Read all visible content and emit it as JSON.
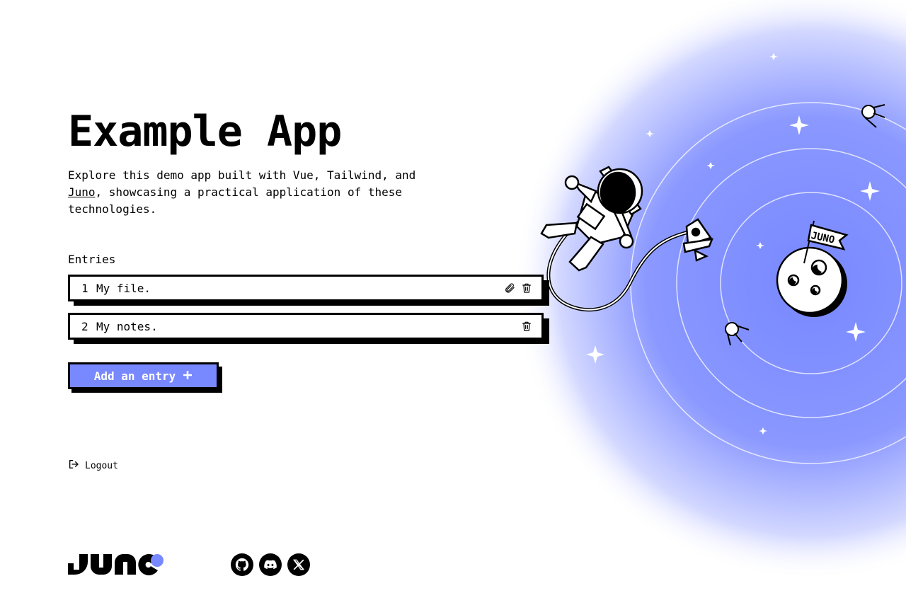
{
  "app": {
    "title": "Example App",
    "intro_before_link": "Explore this demo app built with Vue, Tailwind, and ",
    "intro_link": "Juno",
    "intro_after_link": ", showcasing a practical application of these technologies."
  },
  "entries": {
    "label": "Entries",
    "items": [
      {
        "number": "1",
        "text": "My file.",
        "has_attachment": true
      },
      {
        "number": "2",
        "text": "My notes.",
        "has_attachment": false
      }
    ]
  },
  "actions": {
    "add_entry_label": "Add an entry",
    "logout_label": "Logout"
  },
  "illustration": {
    "flag_text": "JUNO"
  },
  "colors": {
    "accent": "#7888ff",
    "ink": "#000000",
    "background": "#ffffff"
  },
  "footer": {
    "socials": [
      "github-icon",
      "discord-icon",
      "x-icon"
    ]
  }
}
